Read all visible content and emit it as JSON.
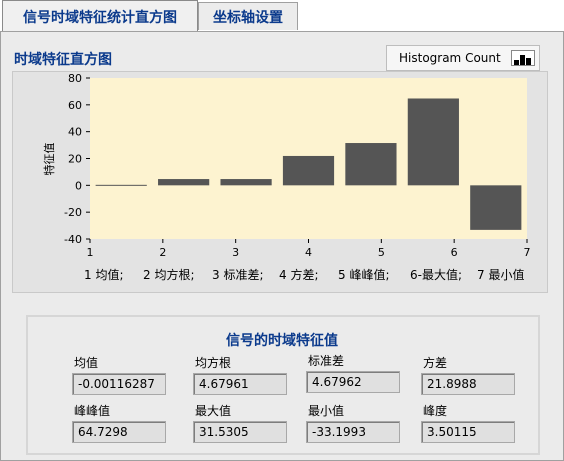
{
  "tabs": [
    {
      "label": "信号时域特征统计直方图",
      "active": true
    },
    {
      "label": "坐标轴设置",
      "active": false
    }
  ],
  "section": {
    "title": "时域特征直方图"
  },
  "legend": {
    "label": "Histogram Count"
  },
  "chart_data": {
    "type": "bar",
    "ylabel": "特征值",
    "categories": [
      "1",
      "2",
      "3",
      "4",
      "5",
      "6",
      "7"
    ],
    "category_names": [
      "1 均值;",
      "2 均方根;",
      "3 标准差;",
      "4 方差;",
      "5 峰峰值;",
      "6-最大值;",
      "7 最小值"
    ],
    "values": [
      -0.00116287,
      4.67961,
      4.67962,
      21.8988,
      31.5305,
      64.7298,
      -33.1993
    ],
    "x_ticks": [
      1,
      2,
      3,
      4,
      5,
      6,
      7
    ],
    "y_ticks": [
      -40,
      -20,
      0,
      20,
      40,
      60,
      80
    ],
    "ylim": [
      -40,
      80
    ],
    "colors": {
      "bar": "#555555",
      "plot_bg": "#fdf3d0"
    }
  },
  "stats": {
    "title": "信号的时域特征值",
    "items": [
      {
        "label": "均值",
        "value": "-0.00116287"
      },
      {
        "label": "均方根",
        "value": "4.67961"
      },
      {
        "label": "标准差",
        "value": "4.67962"
      },
      {
        "label": "方差",
        "value": "21.8988"
      },
      {
        "label": "峰峰值",
        "value": "64.7298"
      },
      {
        "label": "最大值",
        "value": "31.5305"
      },
      {
        "label": "最小值",
        "value": "-33.1993"
      },
      {
        "label": "峰度",
        "value": "3.50115"
      }
    ]
  }
}
